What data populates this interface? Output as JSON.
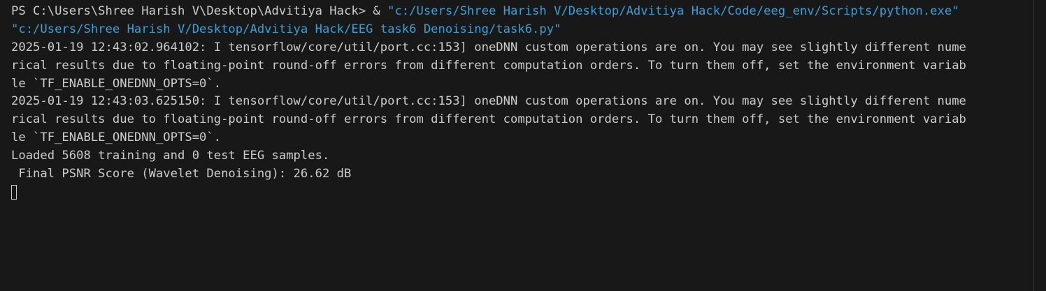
{
  "terminal": {
    "prompt": "PS C:\\Users\\Shree Harish V\\Desktop\\Advitiya Hack> & ",
    "command_path": "\"c:/Users/Shree Harish V/Desktop/Advitiya Hack/Code/eeg_env/Scripts/python.exe\"",
    "command_arg": "\"c:/Users/Shree Harish V/Desktop/Advitiya Hack/EEG task6 Denoising/task6.py\"",
    "output_lines": [
      "2025-01-19 12:43:02.964102: I tensorflow/core/util/port.cc:153] oneDNN custom operations are on. You may see slightly different nume",
      "rical results due to floating-point round-off errors from different computation orders. To turn them off, set the environment variab",
      "le `TF_ENABLE_ONEDNN_OPTS=0`.",
      "2025-01-19 12:43:03.625150: I tensorflow/core/util/port.cc:153] oneDNN custom operations are on. You may see slightly different nume",
      "rical results due to floating-point round-off errors from different computation orders. To turn them off, set the environment variab",
      "le `TF_ENABLE_ONEDNN_OPTS=0`.",
      "Loaded 5608 training and 0 test EEG samples.",
      " Final PSNR Score (Wavelet Denoising): 26.62 dB"
    ],
    "colors": {
      "background": "#181818",
      "text": "#cccccc",
      "string": "#3b9ed6"
    }
  }
}
